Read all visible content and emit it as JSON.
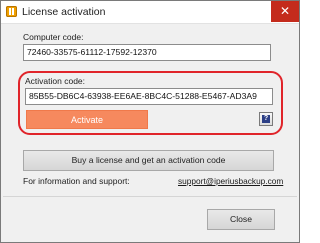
{
  "window": {
    "title": "License activation",
    "close_glyph": "✕"
  },
  "computer_code": {
    "label": "Computer code:",
    "value": "72460-33575-61112-17592-12370"
  },
  "activation_code": {
    "label": "Activation code:",
    "value": "85B55-DB6C4-63938-EE6AE-8BC4C-51288-E5467-AD3A9"
  },
  "buttons": {
    "activate": "Activate",
    "help": "?",
    "buy": "Buy a license and get an activation code",
    "close": "Close"
  },
  "support": {
    "label": "For information and support:",
    "email": "support@iperiusbackup.com"
  },
  "colors": {
    "highlight": "#e0242a",
    "activate_bg": "#f6895e",
    "help_icon": "#2c3f86",
    "close_titlebar": "#c42b1c"
  },
  "icons": {
    "app": "app-logo-icon",
    "close": "close-icon",
    "help": "help-icon"
  }
}
